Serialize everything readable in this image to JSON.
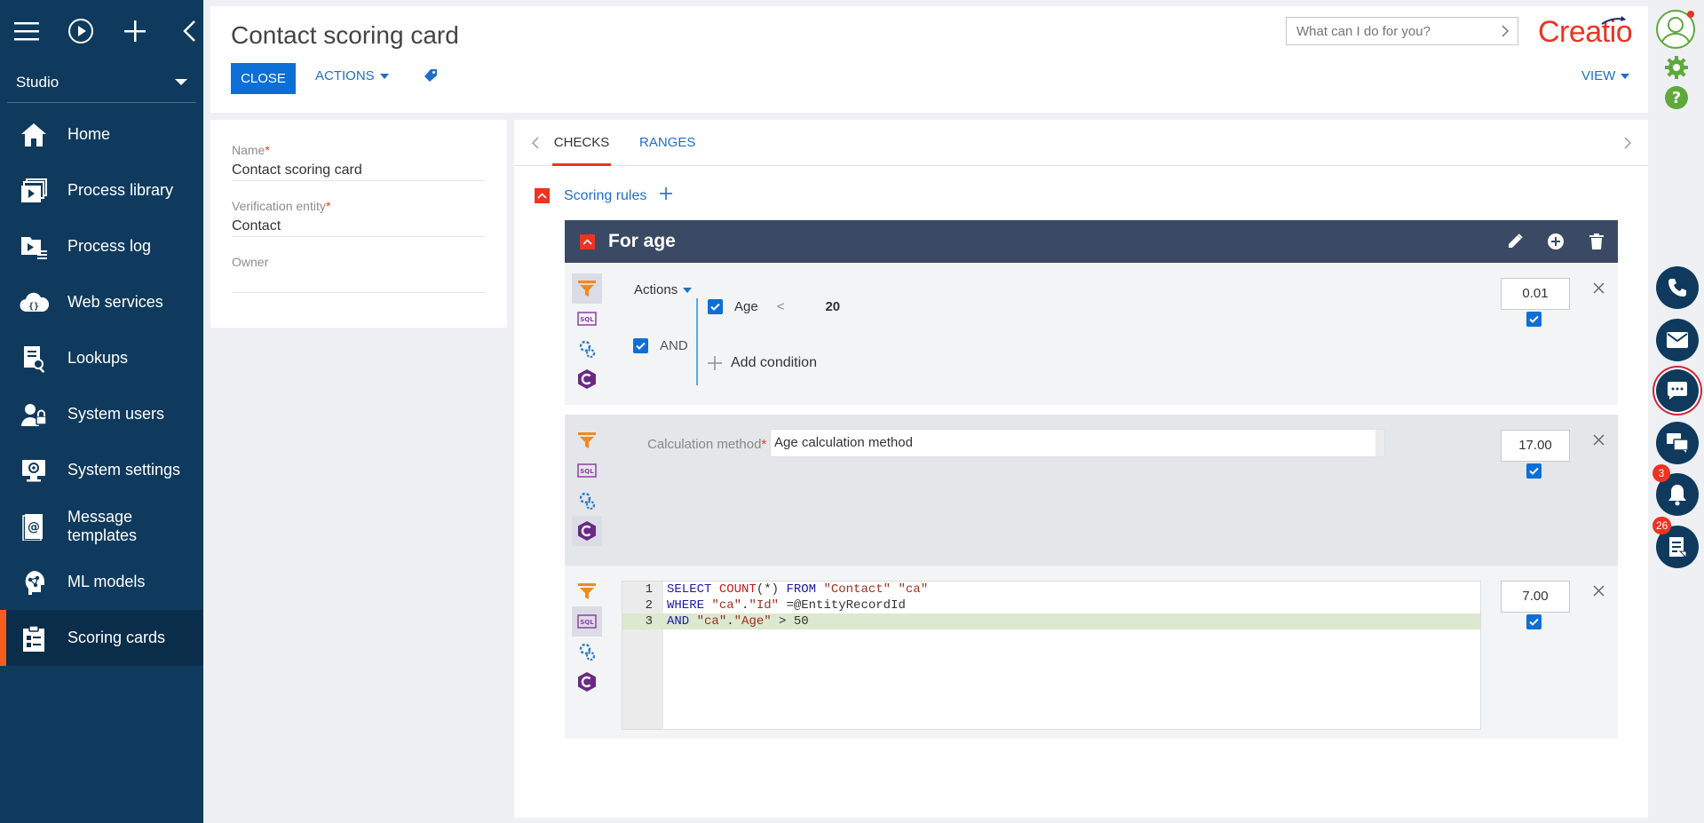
{
  "sidebar": {
    "workplace": "Studio",
    "items": [
      {
        "label": "Home",
        "icon": "home-icon"
      },
      {
        "label": "Process library",
        "icon": "process-library-icon"
      },
      {
        "label": "Process log",
        "icon": "process-log-icon"
      },
      {
        "label": "Web services",
        "icon": "web-services-icon"
      },
      {
        "label": "Lookups",
        "icon": "lookups-icon"
      },
      {
        "label": "System users",
        "icon": "system-users-icon"
      },
      {
        "label": "System settings",
        "icon": "system-settings-icon"
      },
      {
        "label": "Message templates",
        "icon": "message-templates-icon"
      },
      {
        "label": "ML models",
        "icon": "ml-models-icon"
      },
      {
        "label": "Scoring cards",
        "icon": "scoring-cards-icon",
        "active": true
      }
    ]
  },
  "header": {
    "title": "Contact scoring card",
    "close_label": "CLOSE",
    "actions_label": "ACTIONS",
    "view_label": "VIEW",
    "search_placeholder": "What can I do for you?",
    "logo_text": "Creatio"
  },
  "rail": {
    "notifications_count": "3",
    "feed_count": "26"
  },
  "form": {
    "name_label": "Name",
    "name_value": "Contact scoring card",
    "entity_label": "Verification entity",
    "entity_value": "Contact",
    "owner_label": "Owner",
    "owner_value": ""
  },
  "tabs": [
    {
      "label": "CHECKS",
      "active": true
    },
    {
      "label": "RANGES",
      "active": false
    }
  ],
  "scoring": {
    "section_title": "Scoring rules",
    "rule_title": "For age",
    "block1": {
      "actions_label": "Actions",
      "logic_label": "AND",
      "condition": {
        "column": "Age",
        "operator": "<",
        "value": "20"
      },
      "add_condition_label": "Add condition",
      "score": "0.01"
    },
    "block2": {
      "calc_label": "Calculation method",
      "calc_value": "Age calculation method",
      "score": "17.00"
    },
    "block3": {
      "lines": [
        {
          "num": "1",
          "text": "SELECT COUNT(*) FROM \"Contact\" \"ca\""
        },
        {
          "num": "2",
          "text": "WHERE \"ca\".\"Id\" =@EntityRecordId"
        },
        {
          "num": "3",
          "text": "AND \"ca\".\"Age\" > 50"
        }
      ],
      "score": "7.00"
    }
  },
  "colors": {
    "sidebar_bg": "#0f3a5e",
    "accent_orange": "#f55d1e",
    "primary_blue": "#0d6fd6",
    "link_blue": "#1f6fc5",
    "rule_header_bg": "#3a4a65",
    "brand_red": "#ee3322"
  }
}
